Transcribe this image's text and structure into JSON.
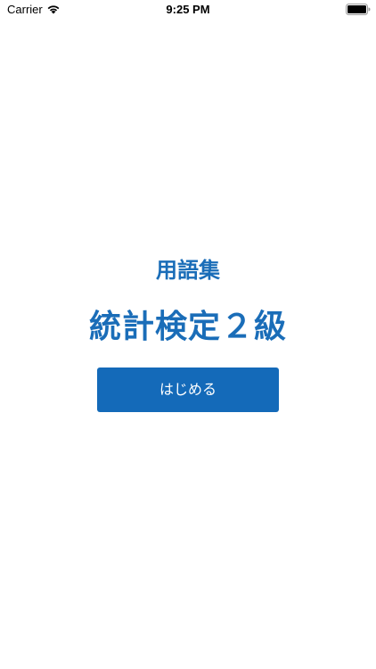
{
  "status_bar": {
    "carrier": "Carrier",
    "time": "9:25 PM",
    "icons": [
      "wifi-icon",
      "battery-icon"
    ]
  },
  "main": {
    "subtitle": "用語集",
    "title": "統計検定２級",
    "start_button_label": "はじめる"
  },
  "colors": {
    "accent": "#1a6db8",
    "button_bg": "#146ab9",
    "button_text": "#ffffff",
    "background": "#ffffff"
  }
}
